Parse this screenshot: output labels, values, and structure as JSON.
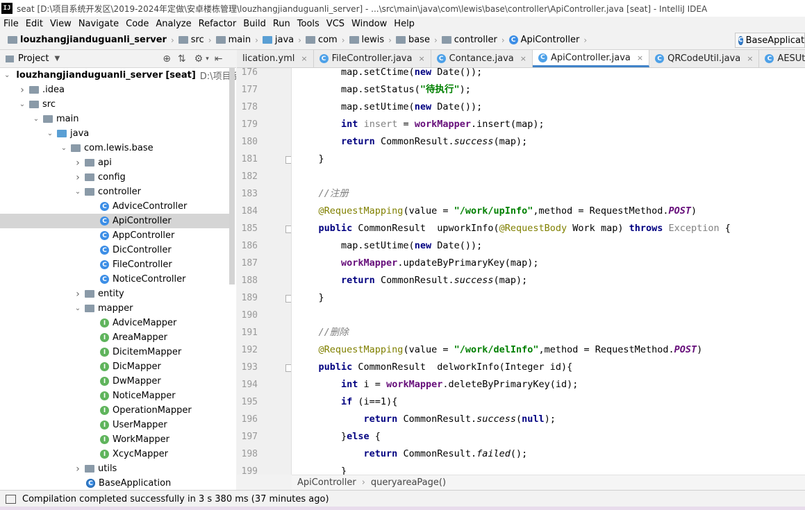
{
  "window": {
    "title": "seat [D:\\项目系统开发区\\2019-2024年定做\\安卓楼栋管理\\louzhangjianduguanli_server] - ...\\src\\main\\java\\com\\lewis\\base\\controller\\ApiController.java [seat] - IntelliJ IDEA",
    "logo": "IJ"
  },
  "menu": [
    "File",
    "Edit",
    "View",
    "Navigate",
    "Code",
    "Analyze",
    "Refactor",
    "Build",
    "Run",
    "Tools",
    "VCS",
    "Window",
    "Help"
  ],
  "breadcrumb": [
    "louzhangjianduguanli_server",
    "src",
    "main",
    "java",
    "com",
    "lewis",
    "base",
    "controller",
    "ApiController"
  ],
  "run_config": "BaseApplicati",
  "project_panel": {
    "title": "Project",
    "tree": [
      {
        "label": "louzhangjianduguanli_server",
        "tag": "[seat]",
        "path": "D:\\项目系统开发",
        "indent": 0,
        "arrow": "down",
        "icon": "folder",
        "bold": true
      },
      {
        "label": ".idea",
        "indent": 1,
        "arrow": "right",
        "icon": "folder"
      },
      {
        "label": "src",
        "indent": 1,
        "arrow": "down",
        "icon": "folder"
      },
      {
        "label": "main",
        "indent": 2,
        "arrow": "down",
        "icon": "folder"
      },
      {
        "label": "java",
        "indent": 3,
        "arrow": "down",
        "icon": "folder-blue"
      },
      {
        "label": "com.lewis.base",
        "indent": 4,
        "arrow": "down",
        "icon": "folder"
      },
      {
        "label": "api",
        "indent": 5,
        "arrow": "right",
        "icon": "folder"
      },
      {
        "label": "config",
        "indent": 5,
        "arrow": "right",
        "icon": "folder"
      },
      {
        "label": "controller",
        "indent": 5,
        "arrow": "down",
        "icon": "folder"
      },
      {
        "label": "AdviceController",
        "indent": 6,
        "icon": "class"
      },
      {
        "label": "ApiController",
        "indent": 6,
        "icon": "class",
        "selected": true
      },
      {
        "label": "AppController",
        "indent": 6,
        "icon": "class"
      },
      {
        "label": "DicController",
        "indent": 6,
        "icon": "class"
      },
      {
        "label": "FileController",
        "indent": 6,
        "icon": "class"
      },
      {
        "label": "NoticeController",
        "indent": 6,
        "icon": "class"
      },
      {
        "label": "entity",
        "indent": 5,
        "arrow": "right",
        "icon": "folder"
      },
      {
        "label": "mapper",
        "indent": 5,
        "arrow": "down",
        "icon": "folder"
      },
      {
        "label": "AdviceMapper",
        "indent": 6,
        "icon": "interface"
      },
      {
        "label": "AreaMapper",
        "indent": 6,
        "icon": "interface"
      },
      {
        "label": "DicitemMapper",
        "indent": 6,
        "icon": "interface"
      },
      {
        "label": "DicMapper",
        "indent": 6,
        "icon": "interface"
      },
      {
        "label": "DwMapper",
        "indent": 6,
        "icon": "interface"
      },
      {
        "label": "NoticeMapper",
        "indent": 6,
        "icon": "interface"
      },
      {
        "label": "OperationMapper",
        "indent": 6,
        "icon": "interface"
      },
      {
        "label": "UserMapper",
        "indent": 6,
        "icon": "interface"
      },
      {
        "label": "WorkMapper",
        "indent": 6,
        "icon": "interface"
      },
      {
        "label": "XcycMapper",
        "indent": 6,
        "icon": "interface"
      },
      {
        "label": "utils",
        "indent": 5,
        "arrow": "right",
        "icon": "folder"
      },
      {
        "label": "BaseApplication",
        "indent": 5,
        "icon": "app"
      }
    ]
  },
  "tabs": [
    {
      "label": "lication.yml",
      "icon": "yml"
    },
    {
      "label": "FileController.java",
      "icon": "class"
    },
    {
      "label": "Contance.java",
      "icon": "class"
    },
    {
      "label": "ApiController.java",
      "icon": "class",
      "active": true
    },
    {
      "label": "QRCodeUtil.java",
      "icon": "class"
    },
    {
      "label": "AESUtil.java",
      "icon": "class"
    }
  ],
  "editor": {
    "lines": [
      {
        "n": "176",
        "html": "        map.setCtime(<span class=\"kw\">new</span> Date());"
      },
      {
        "n": "177",
        "html": "        map.setStatus(<span class=\"str\">\"待执行\"</span>);"
      },
      {
        "n": "178",
        "html": "        map.setUtime(<span class=\"kw\">new</span> Date());"
      },
      {
        "n": "179",
        "html": "        <span class=\"kw\">int</span> <span class=\"unused\">insert</span> = <span class=\"fld\">workMapper</span>.insert(map);"
      },
      {
        "n": "180",
        "html": "        <span class=\"kw\">return</span> CommonResult.<span class=\"it\">success</span>(map);"
      },
      {
        "n": "181",
        "html": "    }"
      },
      {
        "n": "182",
        "html": ""
      },
      {
        "n": "183",
        "html": "    <span class=\"cmt\">//注册</span>"
      },
      {
        "n": "184",
        "html": "    <span class=\"ann\">@RequestMapping</span>(value = <span class=\"str\">\"/work/upInfo\"</span>,method = RequestMethod.<span class=\"cn\">POST</span>)"
      },
      {
        "n": "185",
        "html": "    <span class=\"kw\">public</span> CommonResult  upworkInfo(<span class=\"ann\">@RequestBody</span> Work map) <span class=\"kw\">throws</span> <span class=\"exc\">Exception</span> {"
      },
      {
        "n": "186",
        "html": "        map.setUtime(<span class=\"kw\">new</span> Date());"
      },
      {
        "n": "187",
        "html": "        <span class=\"fld\">workMapper</span>.updateByPrimaryKey(map);"
      },
      {
        "n": "188",
        "html": "        <span class=\"kw\">return</span> CommonResult.<span class=\"it\">success</span>(map);"
      },
      {
        "n": "189",
        "html": "    }"
      },
      {
        "n": "190",
        "html": ""
      },
      {
        "n": "191",
        "html": "    <span class=\"cmt\">//删除</span>"
      },
      {
        "n": "192",
        "html": "    <span class=\"ann\">@RequestMapping</span>(value = <span class=\"str\">\"/work/delInfo\"</span>,method = RequestMethod.<span class=\"cn\">POST</span>)"
      },
      {
        "n": "193",
        "html": "    <span class=\"kw\">public</span> CommonResult  delworkInfo(Integer id){"
      },
      {
        "n": "194",
        "html": "        <span class=\"kw\">int</span> i = <span class=\"fld\">workMapper</span>.deleteByPrimaryKey(id);"
      },
      {
        "n": "195",
        "html": "        <span class=\"kw\">if</span> (i==1){"
      },
      {
        "n": "196",
        "html": "            <span class=\"kw\">return</span> CommonResult.<span class=\"it\">success</span>(<span class=\"kw\">null</span>);"
      },
      {
        "n": "197",
        "html": "        }<span class=\"kw\">else</span> {"
      },
      {
        "n": "198",
        "html": "            <span class=\"kw\">return</span> CommonResult.<span class=\"it\">failed</span>();"
      },
      {
        "n": "199",
        "html": "        }"
      }
    ],
    "breadcrumb": [
      "ApiController",
      "queryareaPage()"
    ]
  },
  "status": {
    "message": "Compilation completed successfully in 3 s 380 ms (37 minutes ago)"
  },
  "colors": {
    "keyword": "#000080",
    "string": "#008000",
    "annotation": "#808000",
    "field": "#660e7a",
    "comment": "#808080",
    "selection": "#d5d5d5"
  }
}
